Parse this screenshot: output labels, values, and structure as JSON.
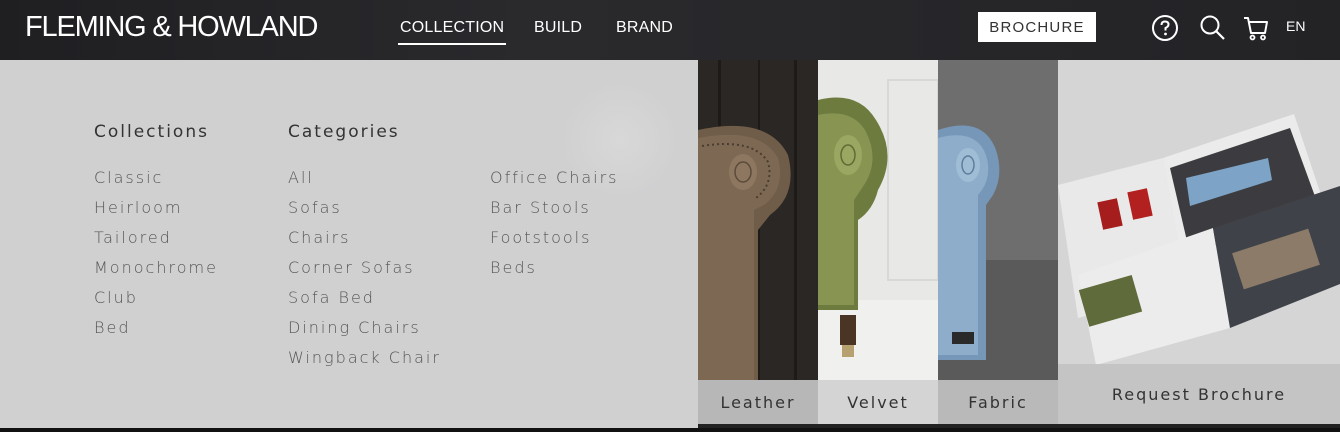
{
  "header": {
    "logo": "FLEMING & HOWLAND",
    "nav": [
      {
        "label": "COLLECTION",
        "active": true
      },
      {
        "label": "BUILD",
        "active": false
      },
      {
        "label": "BRAND",
        "active": false
      }
    ],
    "brochure_button": "BROCHURE",
    "icons": [
      "help-icon",
      "search-icon",
      "cart-icon"
    ],
    "language": "EN"
  },
  "menu": {
    "collections": {
      "heading": "Collections",
      "items": [
        "Classic",
        "Heirloom",
        "Tailored",
        "Monochrome",
        "Club",
        "Bed"
      ]
    },
    "categories": {
      "heading": "Categories",
      "items_col1": [
        "All",
        "Sofas",
        "Chairs",
        "Corner Sofas",
        "Sofa Bed",
        "Dining Chairs",
        "Wingback Chair"
      ],
      "items_col2": [
        "Office Chairs",
        "Bar Stools",
        "Footstools",
        "Beds"
      ]
    }
  },
  "fabrics": [
    {
      "label": "Leather",
      "color": "#7a6650"
    },
    {
      "label": "Velvet",
      "color": "#7c8a4a"
    },
    {
      "label": "Fabric",
      "color": "#7fa0bf"
    }
  ],
  "brochure_panel": {
    "label": "Request Brochure"
  }
}
